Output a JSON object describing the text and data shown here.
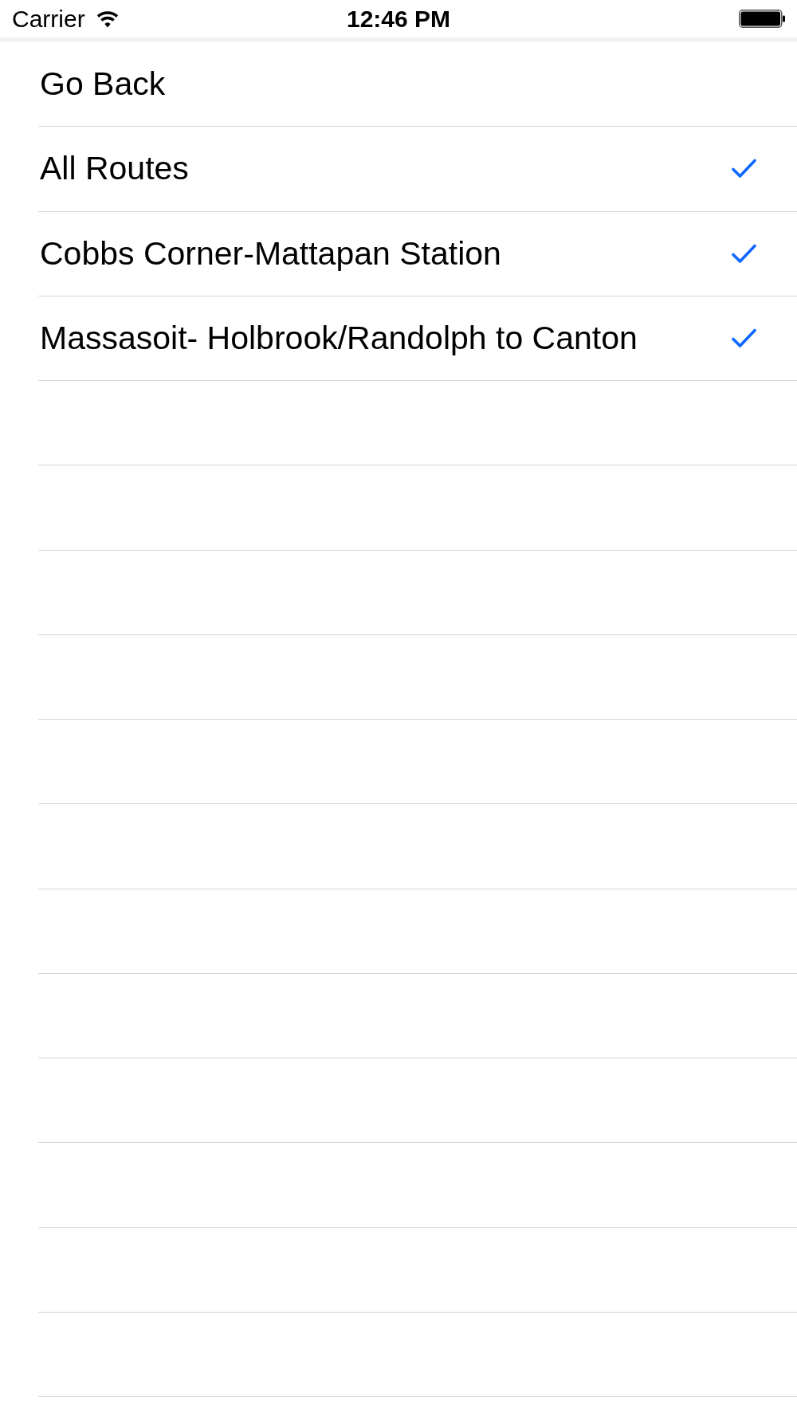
{
  "status_bar": {
    "carrier": "Carrier",
    "time": "12:46 PM"
  },
  "rows": [
    {
      "label": "Go Back",
      "checked": false
    },
    {
      "label": "All Routes",
      "checked": true
    },
    {
      "label": "Cobbs Corner-Mattapan Station",
      "checked": true
    },
    {
      "label": "Massasoit- Holbrook/Randolph to Canton",
      "checked": true
    }
  ]
}
